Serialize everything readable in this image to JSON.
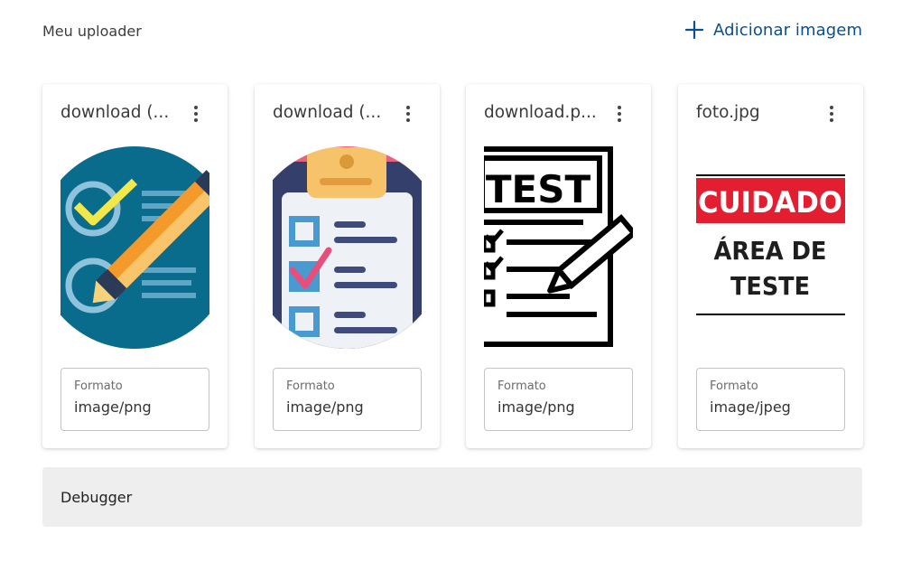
{
  "header": {
    "title": "Meu uploader",
    "add_label": "Adicionar imagem"
  },
  "colors": {
    "accent": "#0b4f8f",
    "debugger_bg": "#eeeeee"
  },
  "cards": [
    {
      "name": "download (...",
      "field_label": "Formato",
      "format": "image/png"
    },
    {
      "name": "download (...",
      "field_label": "Formato",
      "format": "image/png"
    },
    {
      "name": "download.p...",
      "field_label": "Formato",
      "format": "image/png"
    },
    {
      "name": "foto.jpg",
      "field_label": "Formato",
      "format": "image/jpeg",
      "image_text": {
        "line1": "CUIDADO",
        "line2": "ÁREA DE",
        "line3": "TESTE"
      }
    }
  ],
  "card3_image_text": "TEST",
  "debugger": {
    "label": "Debugger"
  }
}
